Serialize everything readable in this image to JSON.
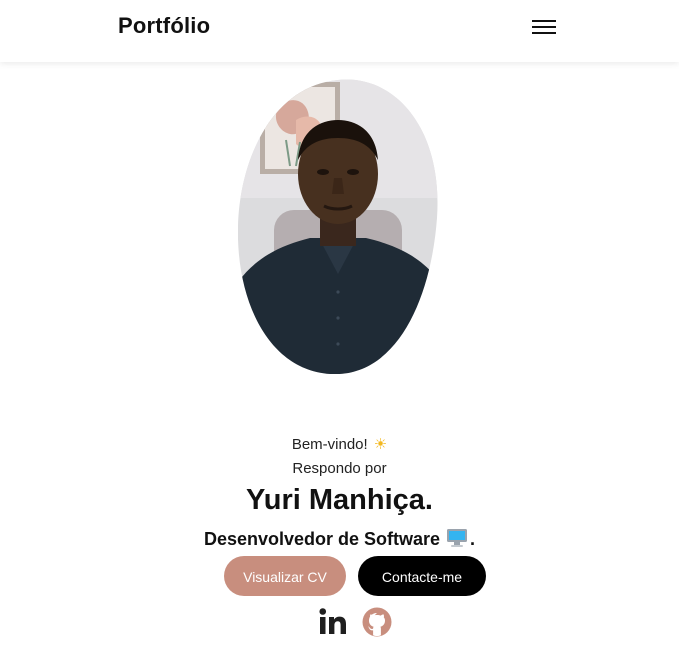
{
  "navbar": {
    "brand": "Portfólio",
    "menu_icon": "hamburger-menu-icon"
  },
  "hero": {
    "photo_icon": "profile-photo",
    "greeting": "Bem-vindo!",
    "greeting_icon": "sun-emoji",
    "intro": "Respondo por",
    "name": "Yuri Manhiça.",
    "role": "Desenvolvedor de Software",
    "role_icon": "computer-emoji",
    "role_suffix": "."
  },
  "buttons": {
    "cv_label": "Visualizar CV",
    "contact_label": "Contacte-me"
  },
  "social": {
    "linkedin_icon": "linkedin-icon",
    "github_icon": "github-icon"
  },
  "colors": {
    "accent": "#c88e7e",
    "primary_button": "#000000",
    "text": "#111111",
    "background": "#ffffff"
  }
}
